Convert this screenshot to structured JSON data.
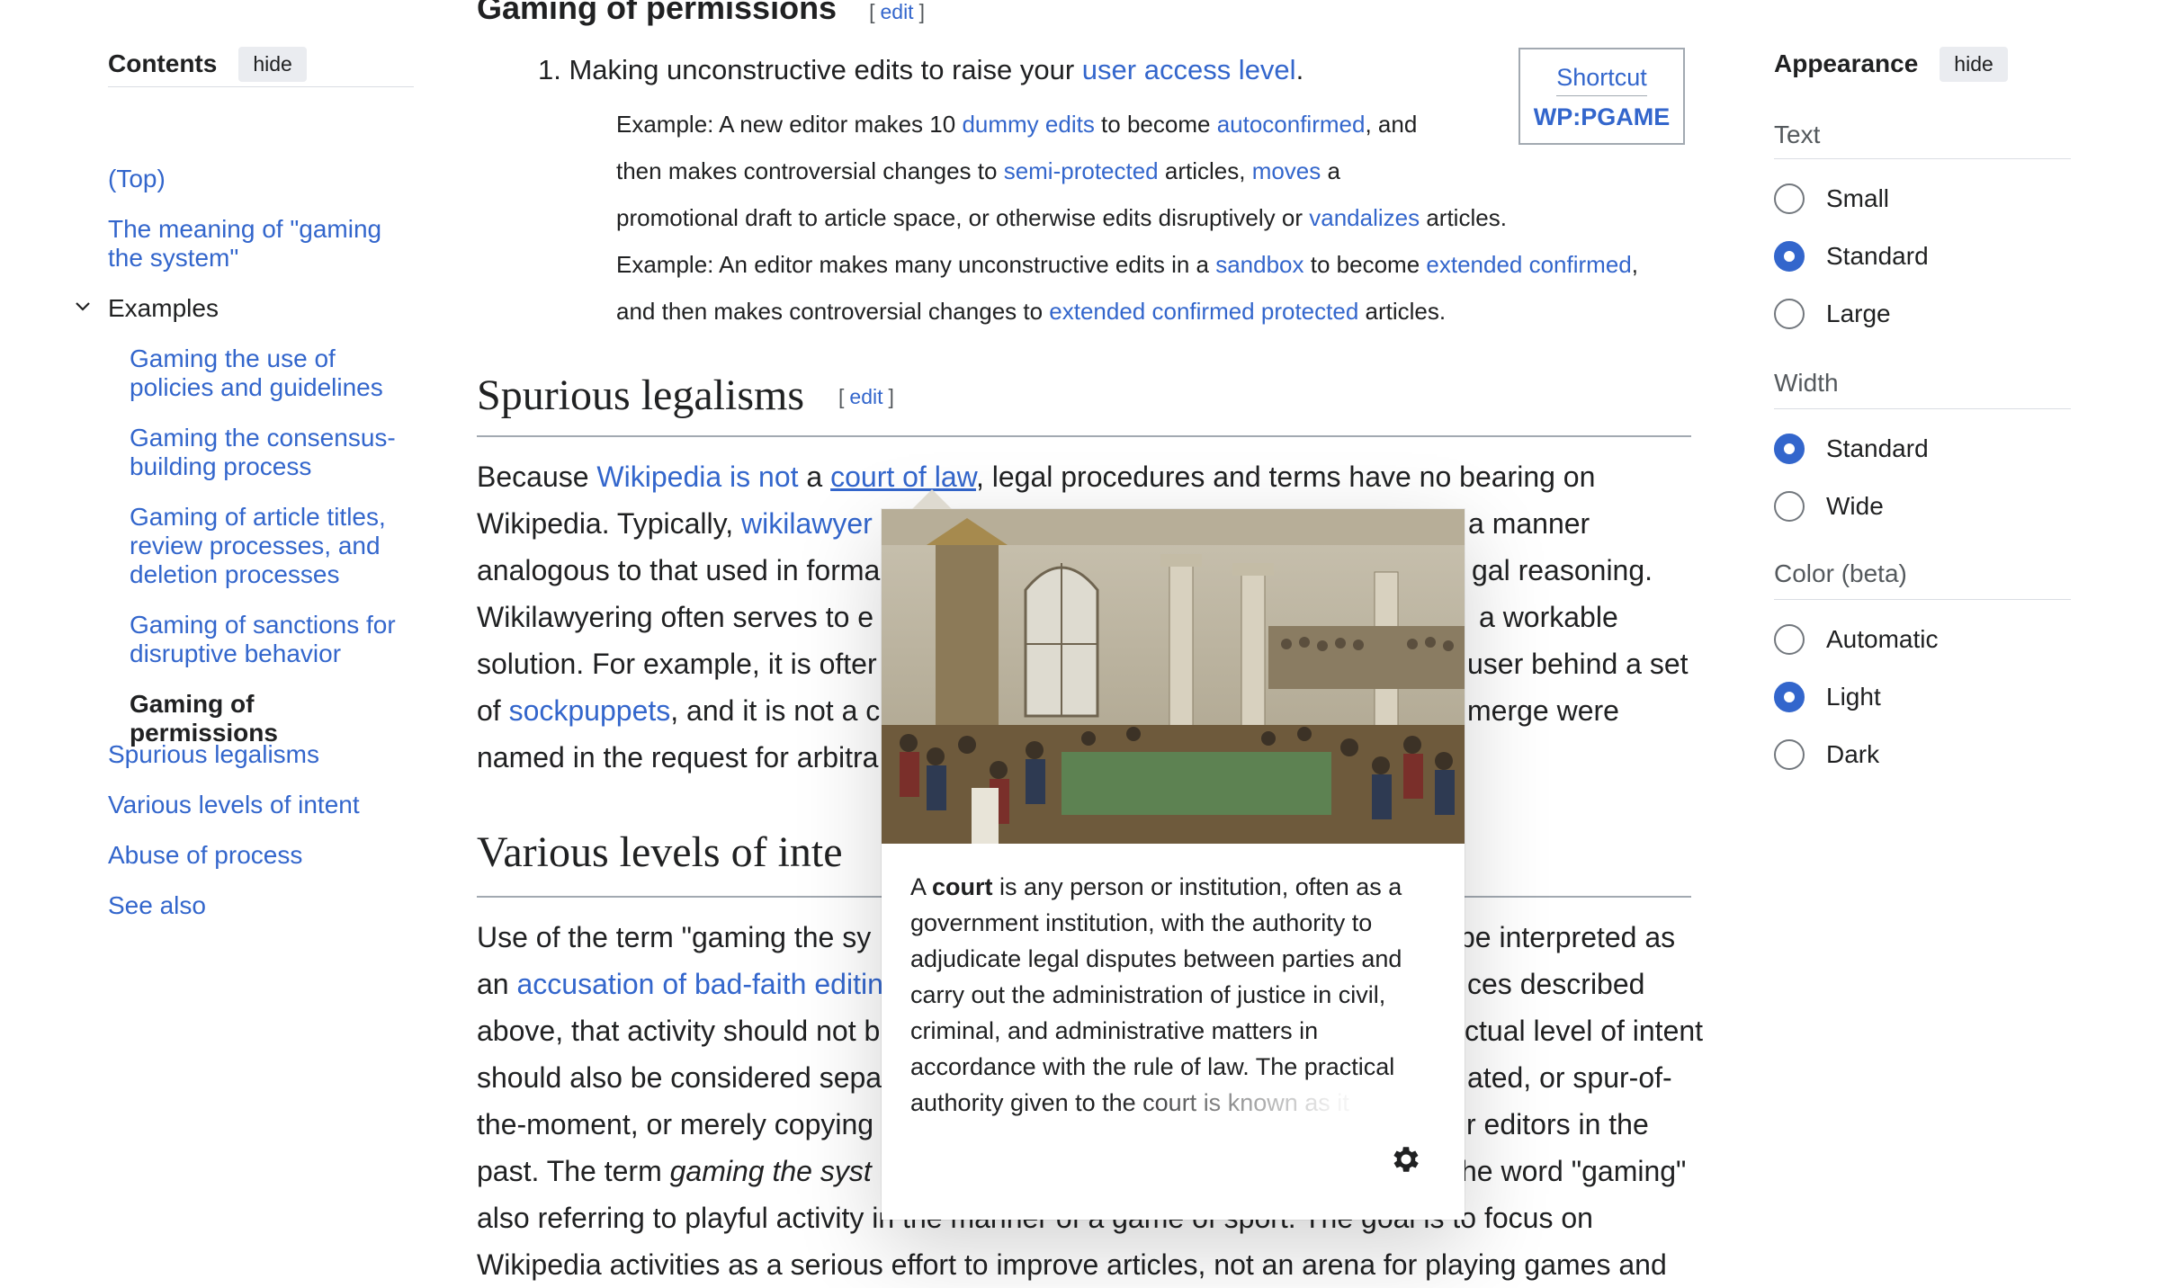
{
  "toc": {
    "title": "Contents",
    "hide_label": "hide",
    "items": [
      {
        "label": "(Top)"
      },
      {
        "label": "The meaning of \"gaming the system\""
      },
      {
        "label": "Examples"
      },
      {
        "label": "Gaming the use of policies and guidelines"
      },
      {
        "label": "Gaming the consensus-building process"
      },
      {
        "label": "Gaming of article titles, review processes, and deletion processes"
      },
      {
        "label": "Gaming of sanctions for disruptive behavior"
      },
      {
        "label": "Gaming of permissions"
      },
      {
        "label": "Spurious legalisms"
      },
      {
        "label": "Various levels of intent"
      },
      {
        "label": "Abuse of process"
      },
      {
        "label": "See also"
      }
    ]
  },
  "main": {
    "section_gaming": {
      "title": "Gaming of permissions",
      "edit_label": "edit",
      "item1_prefix": "1.  Making unconstructive edits to raise your ",
      "item1_link": "user access level",
      "item1_suffix": ".",
      "ex1_line1": [
        "Example: A new editor makes 10 ",
        "dummy edits",
        " to become ",
        "autoconfirmed",
        ", and"
      ],
      "ex1_line2": [
        "then makes controversial changes to ",
        "semi-protected",
        " articles, ",
        "moves",
        " a"
      ],
      "ex1_line3": [
        "promotional draft to article space, or otherwise edits disruptively or ",
        "vandalizes",
        " articles."
      ],
      "ex2_line1": [
        "Example: An editor makes many unconstructive edits in a ",
        "sandbox",
        " to become ",
        "extended confirmed",
        ","
      ],
      "ex2_line2": [
        "and then makes controversial changes to ",
        "extended confirmed protected",
        " articles."
      ]
    },
    "shortcut": {
      "label": "Shortcut",
      "code": "WP:PGAME"
    },
    "section_legalisms": {
      "title": "Spurious legalisms",
      "edit_label": "edit",
      "l1": [
        "Because ",
        "Wikipedia is not",
        " a ",
        "court of law",
        ", legal procedures and terms have no bearing on"
      ],
      "l2a": [
        "Wikipedia. Typically, ",
        "wikilawyer"
      ],
      "l2b": "a manner",
      "l3a": "analogous to that used in forma",
      "l3b": "gal reasoning.",
      "l4a": "Wikilawyering often serves to e",
      "l4b": "a workable",
      "l5a": "solution. For example, it is ofter",
      "l5b": "user behind a set",
      "l6a": [
        "of ",
        "sockpuppets",
        ", and it is not a c"
      ],
      "l6b": "merge were",
      "l7a": "named in the request for arbitra"
    },
    "section_intent": {
      "title": "Various levels of inte",
      "l1a": "Use of the term \"gaming the sy",
      "l1b": "be interpreted as",
      "l2a": [
        "an ",
        "accusation of bad-faith editin"
      ],
      "l2b": "ces described",
      "l3a": "above, that activity should not b",
      "l3b": "ctual level of intent",
      "l4a": "should also be considered sepa",
      "l4b": "ated, or spur-of-",
      "l5a": "the-moment, or merely copying",
      "l5b": "r editors in the",
      "l6a_pre": "past. The term ",
      "l6a_it": "gaming the syst",
      "l6b": "he word \"gaming\"",
      "l7": "also referring to playful activity in the manner of a game of sport. The goal is to focus on",
      "l8": "Wikipedia activities as a serious effort to improve articles, not an arena for playing games and"
    }
  },
  "popup": {
    "extract_pre": "A ",
    "extract_bold": "court",
    "extract_rest": " is any person or institution, often as a government institution, with the authority to adjudicate legal disputes between parties and carry out the administration of justice in civil, criminal, and administrative matters in accordance with the rule of law. The practical authority given to the court is known as it",
    "image_alt": "engraving of a crowded courtroom",
    "settings_icon": "gear-icon"
  },
  "appearance": {
    "title": "Appearance",
    "hide_label": "hide",
    "text_label": "Text",
    "text_options": [
      {
        "label": "Small",
        "selected": false
      },
      {
        "label": "Standard",
        "selected": true
      },
      {
        "label": "Large",
        "selected": false
      }
    ],
    "width_label": "Width",
    "width_options": [
      {
        "label": "Standard",
        "selected": true
      },
      {
        "label": "Wide",
        "selected": false
      }
    ],
    "color_label": "Color (beta)",
    "color_options": [
      {
        "label": "Automatic",
        "selected": false
      },
      {
        "label": "Light",
        "selected": true
      },
      {
        "label": "Dark",
        "selected": false
      }
    ]
  },
  "colors": {
    "link": "#3366cc",
    "text": "#202122",
    "radio_on": "#3366cc"
  }
}
